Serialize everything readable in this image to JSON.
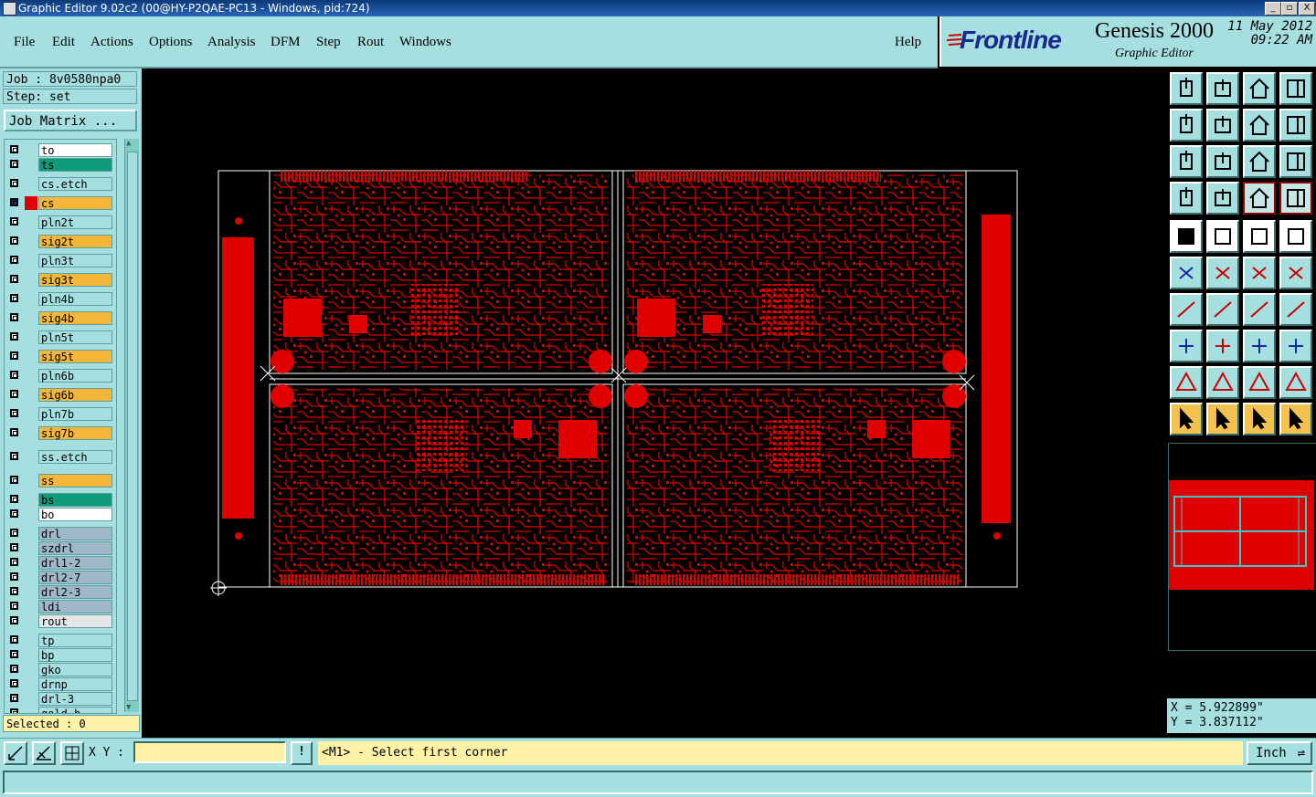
{
  "window": {
    "title": "Graphic Editor 9.02c2 (00@HY-P2QAE-PC13 - Windows, pid:724)",
    "controls": [
      "_",
      "▫",
      "X"
    ]
  },
  "menubar": {
    "items": [
      "File",
      "Edit",
      "Actions",
      "Options",
      "Analysis",
      "DFM",
      "Step",
      "Rout",
      "Windows"
    ],
    "help": "Help"
  },
  "branding": {
    "logo": "Frontline",
    "product": "Genesis 2000",
    "subtitle": "Graphic Editor",
    "date": "11 May 2012",
    "time": "09:22 AM"
  },
  "job": {
    "job_label": "Job : 8v0580npa0",
    "step_label": "Step: set",
    "matrix_button": "Job Matrix ..."
  },
  "layers": [
    {
      "name": "to",
      "color": "#ffffff"
    },
    {
      "name": "ts",
      "color": "#0f9b7a"
    },
    {
      "name": "cs.etch",
      "color": "#a6dfdf"
    },
    {
      "name": "cs",
      "color": "#f4b73a",
      "active": true
    },
    {
      "name": "pln2t",
      "color": "#a6dfdf"
    },
    {
      "name": "sig2t",
      "color": "#f4b73a"
    },
    {
      "name": "pln3t",
      "color": "#a6dfdf"
    },
    {
      "name": "sig3t",
      "color": "#f4b73a"
    },
    {
      "name": "pln4b",
      "color": "#a6dfdf"
    },
    {
      "name": "sig4b",
      "color": "#f4b73a"
    },
    {
      "name": "pln5t",
      "color": "#a6dfdf"
    },
    {
      "name": "sig5t",
      "color": "#f4b73a"
    },
    {
      "name": "pln6b",
      "color": "#a6dfdf"
    },
    {
      "name": "sig6b",
      "color": "#f4b73a"
    },
    {
      "name": "pln7b",
      "color": "#a6dfdf"
    },
    {
      "name": "sig7b",
      "color": "#f4b73a"
    },
    {
      "name": "ss.etch",
      "color": "#a6dfdf"
    },
    {
      "name": "ss",
      "color": "#f4b73a"
    },
    {
      "name": "bs",
      "color": "#0f9b7a"
    },
    {
      "name": "bo",
      "color": "#ffffff"
    },
    {
      "name": "drl",
      "color": "#9fb8c9"
    },
    {
      "name": "szdrl",
      "color": "#9fb8c9"
    },
    {
      "name": "drl1-2",
      "color": "#9fb8c9"
    },
    {
      "name": "drl2-7",
      "color": "#9fb8c9"
    },
    {
      "name": "drl2-3",
      "color": "#9fb8c9"
    },
    {
      "name": "ldi",
      "color": "#9fb8c9"
    },
    {
      "name": "rout",
      "color": "#e6e6e6"
    },
    {
      "name": "tp",
      "color": "#a6dfdf"
    },
    {
      "name": "bp",
      "color": "#a6dfdf"
    },
    {
      "name": "gko",
      "color": "#a6dfdf"
    },
    {
      "name": "drnp",
      "color": "#a6dfdf"
    },
    {
      "name": "drl-3",
      "color": "#a6dfdf"
    },
    {
      "name": "gold_b",
      "color": "#a6dfdf"
    }
  ],
  "selected": "Selected : 0",
  "coords": {
    "x": "X = 5.922899\"",
    "y": "Y = 3.837112\""
  },
  "bottom": {
    "xy_label": "X Y :",
    "xy_value": "",
    "info_button": "!",
    "prompt": "<M1> - Select first corner",
    "units": "Inch"
  },
  "colors": {
    "panel": "#a6dfdf",
    "feature": "#e00000",
    "outline": "#ffffff"
  }
}
